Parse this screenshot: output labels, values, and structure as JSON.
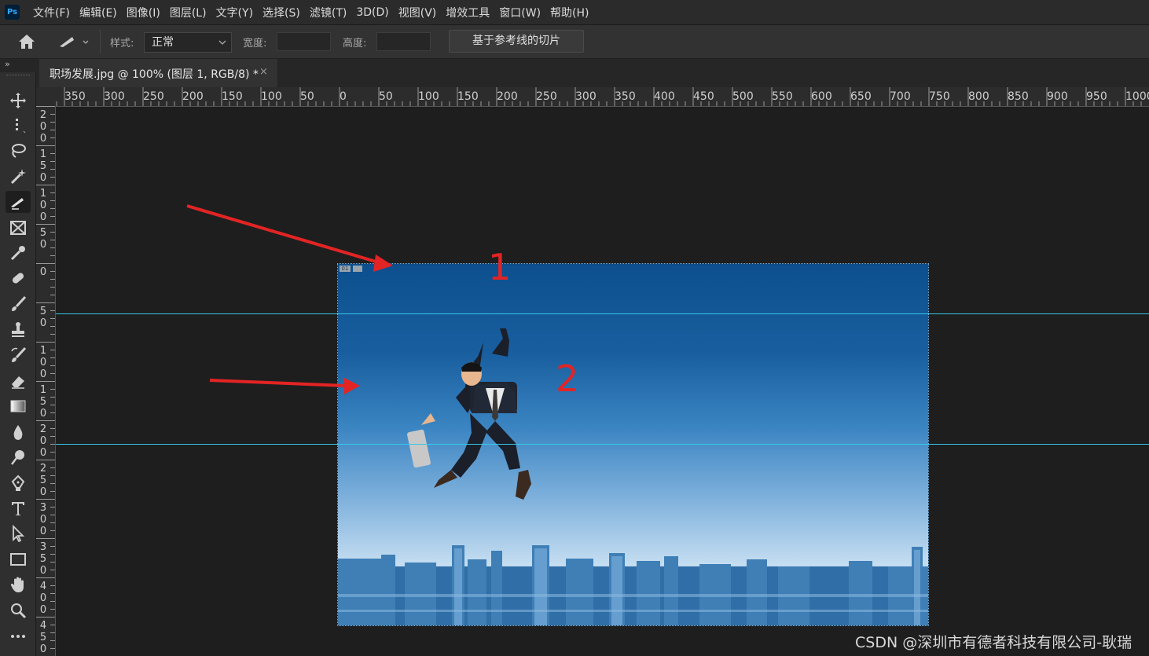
{
  "app": {
    "logo": "Ps"
  },
  "menu": [
    "文件(F)",
    "编辑(E)",
    "图像(I)",
    "图层(L)",
    "文字(Y)",
    "选择(S)",
    "滤镜(T)",
    "3D(D)",
    "视图(V)",
    "增效工具",
    "窗口(W)",
    "帮助(H)"
  ],
  "options": {
    "style_label": "样式:",
    "style_value": "正常",
    "width_label": "宽度:",
    "height_label": "高度:",
    "slice_button": "基于参考线的切片"
  },
  "document_tab": {
    "title": "职场发展.jpg @ 100% (图层 1, RGB/8) *",
    "close": "×"
  },
  "ruler": {
    "horizontal": [
      "350",
      "300",
      "250",
      "200",
      "150",
      "100",
      "50",
      "0",
      "50",
      "100",
      "150",
      "200",
      "250",
      "300",
      "350",
      "400",
      "450",
      "500",
      "550",
      "600",
      "650",
      "700",
      "750",
      "800",
      "850",
      "900",
      "950",
      "1000"
    ],
    "vertical": [
      "200",
      "150",
      "100",
      "50",
      "0",
      "50",
      "100",
      "150",
      "200",
      "250",
      "300",
      "350",
      "400",
      "450"
    ]
  },
  "tools": [
    "move-tool",
    "marquee-tool",
    "lasso-tool",
    "magic-wand-tool",
    "slice-tool",
    "frame-tool",
    "eyedropper-tool",
    "healing-brush-tool",
    "brush-tool",
    "clone-stamp-tool",
    "history-brush-tool",
    "eraser-tool",
    "gradient-tool",
    "blur-tool",
    "dodge-tool",
    "pen-tool",
    "type-tool",
    "path-selection-tool",
    "rectangle-tool",
    "hand-tool",
    "zoom-tool",
    "more-tools"
  ],
  "active_tool": "slice-tool",
  "annotations": {
    "label1": "1",
    "label2": "2",
    "color": "#e32424"
  },
  "slice": {
    "badge": "01"
  },
  "guide_color": "#36c7e6",
  "watermark": "CSDN @深圳市有德者科技有限公司-耿瑞"
}
